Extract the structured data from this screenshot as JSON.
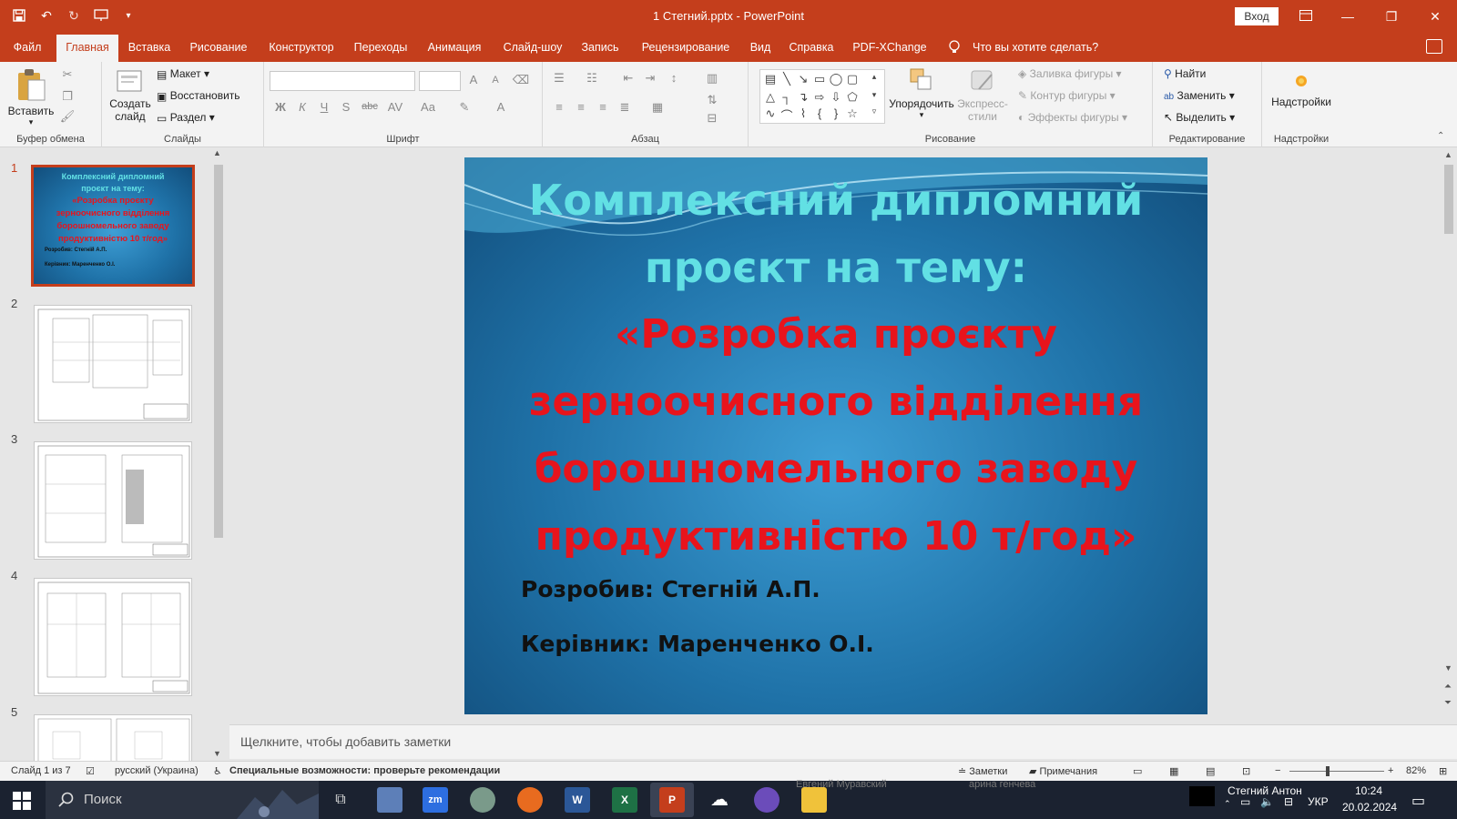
{
  "window": {
    "title": "1 Стегний.pptx  -  PowerPoint",
    "signin_label": "Вход",
    "minimize": "—",
    "restore": "❐",
    "close": "✕"
  },
  "tabs": [
    {
      "label": "Файл"
    },
    {
      "label": "Главная"
    },
    {
      "label": "Вставка"
    },
    {
      "label": "Рисование"
    },
    {
      "label": "Конструктор"
    },
    {
      "label": "Переходы"
    },
    {
      "label": "Анимация"
    },
    {
      "label": "Слайд-шоу"
    },
    {
      "label": "Запись"
    },
    {
      "label": "Рецензирование"
    },
    {
      "label": "Вид"
    },
    {
      "label": "Справка"
    },
    {
      "label": "PDF-XChange"
    }
  ],
  "active_tab": "Главная",
  "tell_me": "Что вы хотите сделать?",
  "ribbon": {
    "clipboard": {
      "paste": "Вставить",
      "label": "Буфер обмена"
    },
    "slides": {
      "new_slide_1": "Создать",
      "new_slide_2": "слайд",
      "layout": "Макет",
      "reset": "Восстановить",
      "section": "Раздел",
      "label": "Слайды"
    },
    "font": {
      "bold": "Ж",
      "italic": "К",
      "underline": "Ч",
      "shadow": "S",
      "strike": "abc",
      "spacing": "AV",
      "case": "Aa",
      "color": "A",
      "grow": "A",
      "shrink": "A",
      "label": "Шрифт"
    },
    "paragraph": {
      "label": "Абзац"
    },
    "drawing": {
      "arrange": "Упорядочить",
      "quick_styles_1": "Экспресс-",
      "quick_styles_2": "стили",
      "fill": "Заливка фигуры",
      "outline": "Контур фигуры",
      "effects": "Эффекты фигуры",
      "label": "Рисование"
    },
    "editing": {
      "find": "Найти",
      "replace": "Заменить",
      "select": "Выделить",
      "label": "Редактирование"
    },
    "addins": {
      "addins": "Надстройки",
      "label": "Надстройки"
    }
  },
  "thumbnails": [
    {
      "num": "1",
      "selected": true,
      "line1": "Комплексний дипломний",
      "line2": "проєкт на тему:",
      "red1": "«Розробка проєкту",
      "red2": "зерноочисного відділення",
      "red3": "борошномельного заводу",
      "red4": "продуктивністю 10 т/год»",
      "small1": "Розробив: Стегній А.П.",
      "small2": "Керівник: Маренченко О.І."
    },
    {
      "num": "2",
      "selected": false
    },
    {
      "num": "3",
      "selected": false
    },
    {
      "num": "4",
      "selected": false
    },
    {
      "num": "5",
      "selected": false
    }
  ],
  "slide": {
    "title_line1": "Комплексний дипломний",
    "title_line2": "проєкт на тему:",
    "topic_line1": "«Розробка проєкту",
    "topic_line2": "зерноочисного відділення",
    "topic_line3": "борошномельного заводу",
    "topic_line4": "продуктивністю 10 т/год»",
    "author": "Розробив: Стегній А.П.",
    "supervisor": "Керівник: Маренченко О.І.",
    "colors": {
      "title": "#62e0e4",
      "topic": "#e8141c",
      "text": "#111111"
    }
  },
  "notes_placeholder": "Щелкните, чтобы добавить заметки",
  "statusbar": {
    "slide_counter": "Слайд 1 из 7",
    "language": "русский (Украина)",
    "accessibility": "Специальные возможности: проверьте рекомендации",
    "notes": "Заметки",
    "comments": "Примечания",
    "zoom": "82%"
  },
  "taskbar": {
    "search_placeholder": "Поиск",
    "user_label": "Стегний Антон",
    "language": "УКР",
    "time": "10:24",
    "date": "20.02.2024",
    "ghost1": "Евгений Муравский",
    "ghost2": "арина генчева"
  },
  "accent_color": "#c43e1c"
}
